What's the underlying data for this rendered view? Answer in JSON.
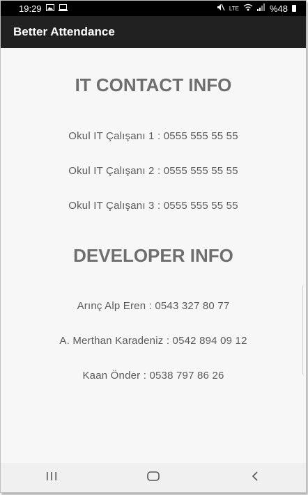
{
  "status_bar": {
    "time": "19:29",
    "battery": "%48",
    "net": "LTE"
  },
  "app_bar": {
    "title": "Better Attendance"
  },
  "it_section": {
    "heading": "IT CONTACT INFO",
    "entries": [
      "Okul IT Çalışanı 1 : 0555 555 55 55",
      "Okul IT Çalışanı 2 : 0555 555 55 55",
      "Okul IT Çalışanı 3 : 0555 555 55 55"
    ]
  },
  "dev_section": {
    "heading": "DEVELOPER INFO",
    "entries": [
      "Arınç Alp Eren : 0543 327 80 77",
      "A. Merthan Karadeniz : 0542 894 09 12",
      "Kaan Önder : 0538 797 86 26"
    ]
  },
  "icons": {
    "status_left": [
      "image-icon",
      "monitor-icon"
    ],
    "status_right": [
      "mute-icon",
      "volte-icon",
      "wifi-icon",
      "signal-icon",
      "battery-icon"
    ],
    "nav": [
      "recents-icon",
      "home-icon",
      "back-icon"
    ]
  },
  "colors": {
    "app_bar": "#212121",
    "status_bar": "#000000",
    "heading": "#6e6e6e",
    "text": "#5a5a5a"
  }
}
